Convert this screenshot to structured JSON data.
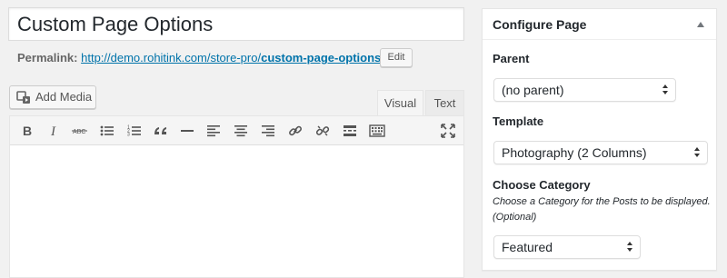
{
  "post": {
    "title": "Custom Page Options"
  },
  "permalink": {
    "label": "Permalink:",
    "url_base": "http://demo.rohitink.com/store-pro/",
    "url_slug": "custom-page-options",
    "url_trail": "/",
    "edit_label": "Edit"
  },
  "editor": {
    "add_media_label": "Add Media",
    "tabs": [
      {
        "label": "Visual",
        "active": true
      },
      {
        "label": "Text",
        "active": false
      }
    ],
    "toolbar_icons": [
      "bold-icon",
      "italic-icon",
      "strikethrough-icon",
      "bullet-list-icon",
      "numbered-list-icon",
      "blockquote-icon",
      "horizontal-line-icon",
      "align-left-icon",
      "align-center-icon",
      "align-right-icon",
      "insert-link-icon",
      "remove-link-icon",
      "read-more-icon",
      "toolbar-toggle-icon",
      "fullscreen-icon"
    ]
  },
  "sidebar": {
    "box_title": "Configure Page",
    "parent": {
      "label": "Parent",
      "selected": "(no parent)"
    },
    "template": {
      "label": "Template",
      "selected": "Photography (2 Columns)"
    },
    "category": {
      "label": "Choose Category",
      "description": "Choose a Category for the Posts to be displayed. (Optional)",
      "selected": "Featured"
    }
  },
  "colors": {
    "link": "#0073aa",
    "background": "#f1f1f1",
    "text": "#23282d"
  }
}
